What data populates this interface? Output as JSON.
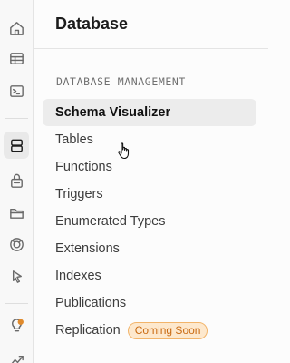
{
  "rail": {
    "items": [
      {
        "icon": "home-icon"
      },
      {
        "icon": "table-editor-icon"
      },
      {
        "icon": "sql-editor-icon"
      },
      {
        "icon": "database-icon",
        "active": true
      },
      {
        "icon": "auth-lock-icon"
      },
      {
        "icon": "storage-folder-icon"
      },
      {
        "icon": "realtime-icon"
      },
      {
        "icon": "edge-functions-cursor-icon"
      },
      {
        "icon": "advisor-lightbulb-icon"
      },
      {
        "icon": "reports-chart-icon"
      }
    ]
  },
  "panel": {
    "title": "Database",
    "section_label": "DATABASE MANAGEMENT",
    "items": [
      {
        "label": "Schema Visualizer",
        "active": true
      },
      {
        "label": "Tables"
      },
      {
        "label": "Functions"
      },
      {
        "label": "Triggers"
      },
      {
        "label": "Enumerated Types"
      },
      {
        "label": "Extensions"
      },
      {
        "label": "Indexes"
      },
      {
        "label": "Publications"
      },
      {
        "label": "Replication",
        "badge": "Coming Soon"
      }
    ]
  },
  "colors": {
    "badge_text": "#c96a12",
    "badge_bg": "#fde8cd",
    "badge_border": "#f2b46a",
    "active_bg": "#ececec"
  }
}
